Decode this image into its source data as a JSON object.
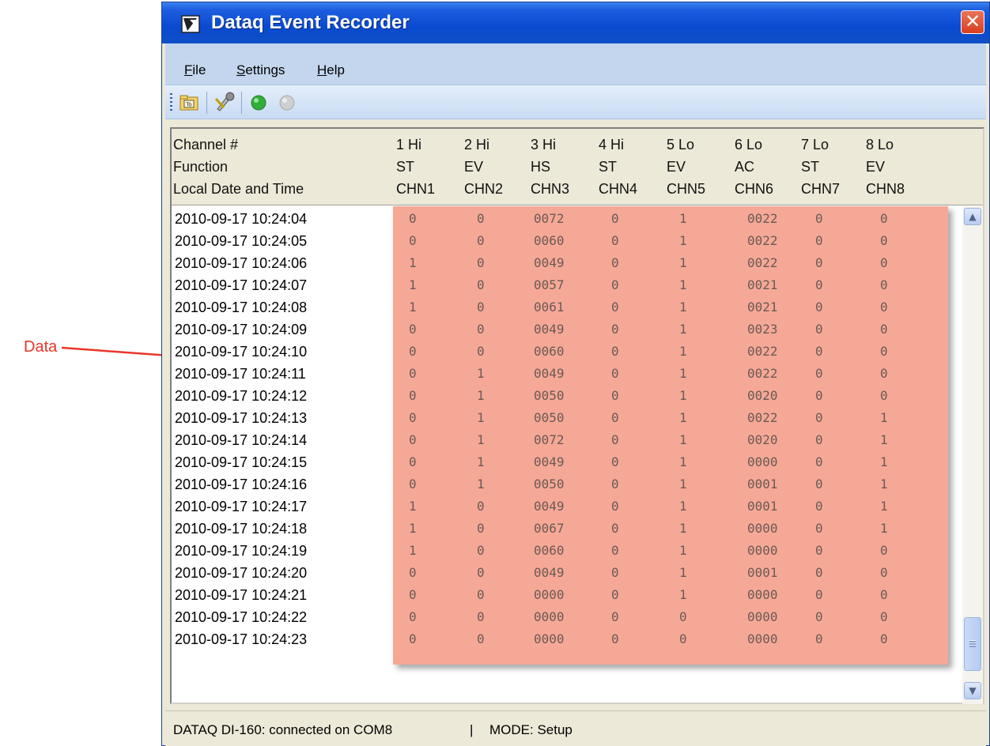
{
  "annotation": {
    "label": "Data"
  },
  "window": {
    "title": "Dataq Event Recorder"
  },
  "menu": [
    {
      "label": "File"
    },
    {
      "label": "Settings"
    },
    {
      "label": "Help"
    }
  ],
  "toolbar": {
    "icons": [
      "open-config-icon",
      "tools-icon",
      "start-icon",
      "stop-icon"
    ]
  },
  "table": {
    "row_labels": [
      "Channel #",
      "Function",
      "Local Date and Time"
    ],
    "columns": [
      {
        "channel": "1 Hi",
        "function": "ST",
        "name": "CHN1"
      },
      {
        "channel": "2 Hi",
        "function": "EV",
        "name": "CHN2"
      },
      {
        "channel": "3 Hi",
        "function": "HS",
        "name": "CHN3"
      },
      {
        "channel": "4 Hi",
        "function": "ST",
        "name": "CHN4"
      },
      {
        "channel": "5 Lo",
        "function": "EV",
        "name": "CHN5"
      },
      {
        "channel": "6 Lo",
        "function": "AC",
        "name": "CHN6"
      },
      {
        "channel": "7 Lo",
        "function": "ST",
        "name": "CHN7"
      },
      {
        "channel": "8 Lo",
        "function": "EV",
        "name": "CHN8"
      }
    ],
    "rows": [
      {
        "time": "2010-09-17 10:24:04",
        "values": [
          "0",
          "0",
          "0072",
          "0",
          "1",
          "0022",
          "0",
          "0"
        ]
      },
      {
        "time": "2010-09-17 10:24:05",
        "values": [
          "0",
          "0",
          "0060",
          "0",
          "1",
          "0022",
          "0",
          "0"
        ]
      },
      {
        "time": "2010-09-17 10:24:06",
        "values": [
          "1",
          "0",
          "0049",
          "0",
          "1",
          "0022",
          "0",
          "0"
        ]
      },
      {
        "time": "2010-09-17 10:24:07",
        "values": [
          "1",
          "0",
          "0057",
          "0",
          "1",
          "0021",
          "0",
          "0"
        ]
      },
      {
        "time": "2010-09-17 10:24:08",
        "values": [
          "1",
          "0",
          "0061",
          "0",
          "1",
          "0021",
          "0",
          "0"
        ]
      },
      {
        "time": "2010-09-17 10:24:09",
        "values": [
          "0",
          "0",
          "0049",
          "0",
          "1",
          "0023",
          "0",
          "0"
        ]
      },
      {
        "time": "2010-09-17 10:24:10",
        "values": [
          "0",
          "0",
          "0060",
          "0",
          "1",
          "0022",
          "0",
          "0"
        ]
      },
      {
        "time": "2010-09-17 10:24:11",
        "values": [
          "0",
          "1",
          "0049",
          "0",
          "1",
          "0022",
          "0",
          "0"
        ]
      },
      {
        "time": "2010-09-17 10:24:12",
        "values": [
          "0",
          "1",
          "0050",
          "0",
          "1",
          "0020",
          "0",
          "0"
        ]
      },
      {
        "time": "2010-09-17 10:24:13",
        "values": [
          "0",
          "1",
          "0050",
          "0",
          "1",
          "0022",
          "0",
          "1"
        ]
      },
      {
        "time": "2010-09-17 10:24:14",
        "values": [
          "0",
          "1",
          "0072",
          "0",
          "1",
          "0020",
          "0",
          "1"
        ]
      },
      {
        "time": "2010-09-17 10:24:15",
        "values": [
          "0",
          "1",
          "0049",
          "0",
          "1",
          "0000",
          "0",
          "1"
        ]
      },
      {
        "time": "2010-09-17 10:24:16",
        "values": [
          "0",
          "1",
          "0050",
          "0",
          "1",
          "0001",
          "0",
          "1"
        ]
      },
      {
        "time": "2010-09-17 10:24:17",
        "values": [
          "1",
          "0",
          "0049",
          "0",
          "1",
          "0001",
          "0",
          "1"
        ]
      },
      {
        "time": "2010-09-17 10:24:18",
        "values": [
          "1",
          "0",
          "0067",
          "0",
          "1",
          "0000",
          "0",
          "1"
        ]
      },
      {
        "time": "2010-09-17 10:24:19",
        "values": [
          "1",
          "0",
          "0060",
          "0",
          "1",
          "0000",
          "0",
          "0"
        ]
      },
      {
        "time": "2010-09-17 10:24:20",
        "values": [
          "0",
          "0",
          "0049",
          "0",
          "1",
          "0001",
          "0",
          "0"
        ]
      },
      {
        "time": "2010-09-17 10:24:21",
        "values": [
          "0",
          "0",
          "0000",
          "0",
          "1",
          "0000",
          "0",
          "0"
        ]
      },
      {
        "time": "2010-09-17 10:24:22",
        "values": [
          "0",
          "0",
          "0000",
          "0",
          "0",
          "0000",
          "0",
          "0"
        ]
      },
      {
        "time": "2010-09-17 10:24:23",
        "values": [
          "0",
          "0",
          "0000",
          "0",
          "0",
          "0000",
          "0",
          "0"
        ]
      }
    ]
  },
  "status": {
    "connection": "DATAQ DI-160: connected on COM8",
    "separator": "|",
    "mode": "MODE:   Setup"
  },
  "colors": {
    "data_highlight": "#f6a896",
    "annotation": "#e8362a",
    "titlebar": "#0a4ad0",
    "menubar": "#c3d6ee"
  }
}
